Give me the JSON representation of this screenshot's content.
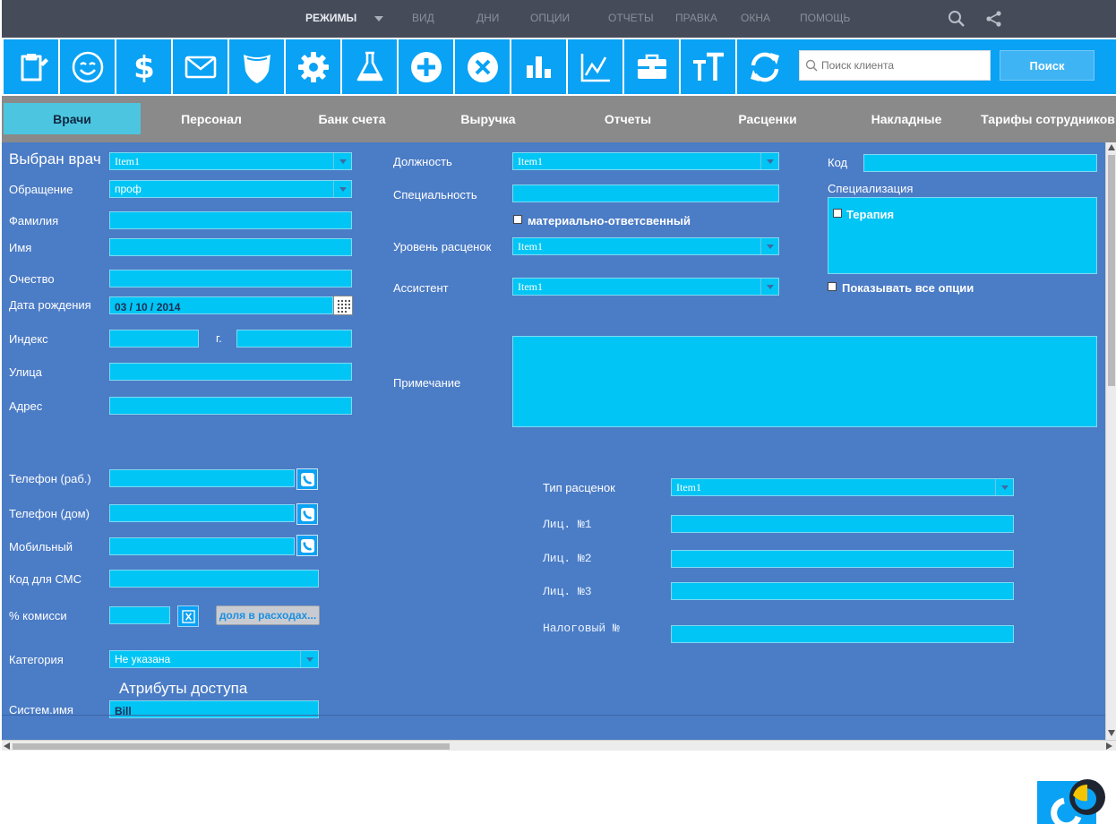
{
  "menu": {
    "items": [
      "РЕЖИМЫ",
      "ВИД",
      "ДНИ",
      "ОПЦИИ",
      "ОТЧЕТЫ",
      "ПРАВКА",
      "ОКНА",
      "ПОМОЩЬ"
    ],
    "icons": [
      "search-icon",
      "share-icon"
    ]
  },
  "toolbar": {
    "icons": [
      "clipboard-icon",
      "smile-icon",
      "dollar-icon",
      "envelope-icon",
      "shield-icon",
      "gear-icon",
      "flask-icon",
      "plus-circle-icon",
      "close-circle-icon",
      "bar-chart-icon",
      "line-chart-icon",
      "briefcase-icon",
      "text-size-icon",
      "refresh-icon"
    ],
    "search_placeholder": "Поиск клиента",
    "search_button": "Поиск"
  },
  "tabs": [
    "Врачи",
    "Персонал",
    "Банк счета",
    "Выручка",
    "Отчеты",
    "Расценки",
    "Накладные",
    "Тарифы сотрудников"
  ],
  "form": {
    "selected_doctor_label": "Выбран врач",
    "selected_doctor_value": "Item1",
    "salutation_label": "Обращение",
    "salutation_value": "проф",
    "lastname_label": "Фамилия",
    "firstname_label": "Имя",
    "patronymic_label": "Очество",
    "birthdate_label": "Дата рождения",
    "birthdate_value": "03 / 10 / 2014",
    "index_label": "Индекс",
    "city_label": "г.",
    "street_label": "Улица",
    "address_label": "Адрес",
    "phone_work_label": "Телефон (раб.)",
    "phone_home_label": "Телефон (дом)",
    "mobile_label": "Мобильный",
    "sms_code_label": "Код для СМС",
    "commission_label": "% комисси",
    "share_button": "доля в расходах...",
    "category_label": "Категория",
    "category_value": "Не указана",
    "access_attributes_title": "Атрибуты доступа",
    "sysname_label": "Систем.имя",
    "sysname_value": "Bill",
    "position_label": "Должность",
    "position_value": "Item1",
    "specialty_label": "Специальность",
    "financially_responsible_label": "материально-ответсвенный",
    "price_level_label": "Уровень расценок",
    "price_level_value": "Item1",
    "assistant_label": "Ассистент",
    "assistant_value": "Item1",
    "note_label": "Примечание",
    "code_label": "Код",
    "specialization_label": "Специализация",
    "specialization_item": "Терапия",
    "show_all_options_label": "Показывать все опции",
    "price_type_label": "Тип расценок",
    "price_type_value": "Item1",
    "license1_label": "Лиц. №1",
    "license2_label": "Лиц. №2",
    "license3_label": "Лиц. №3",
    "tax_number_label": "Налоговый №"
  },
  "colors": {
    "menubar": "#454b59",
    "toolbar_blue": "#0aa2f4",
    "tabbar": "#8a8a8a",
    "active_tab": "#4cc6e0",
    "form_bg": "#4b7cc6",
    "field": "#00c5f5"
  }
}
